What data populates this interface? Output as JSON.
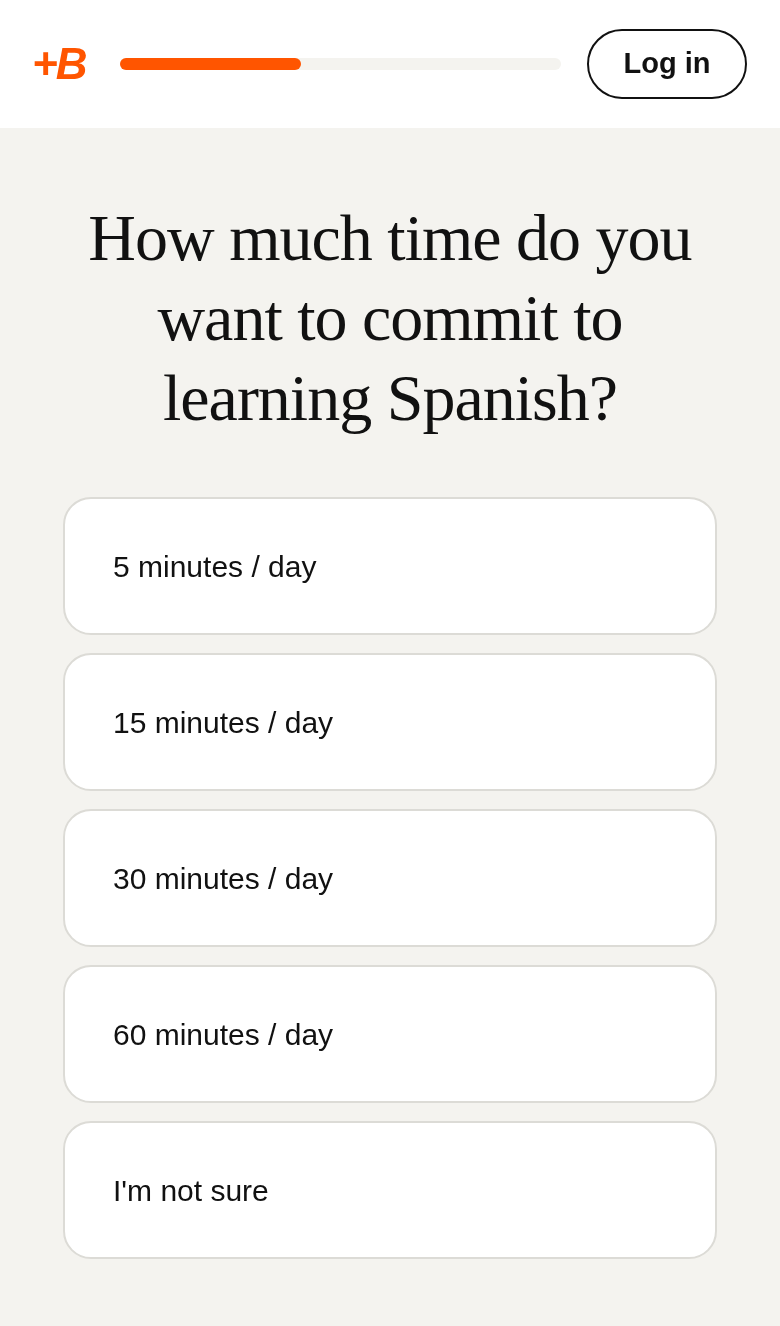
{
  "header": {
    "logo": "+B",
    "progress": {
      "level": 0.41
    },
    "login_button": "Log in"
  },
  "question": "How much time do you want to commit to learning Spanish?",
  "options": [
    {
      "label": "5 minutes / day",
      "selected": false
    },
    {
      "label": "15 minutes / day",
      "selected": false
    },
    {
      "label": "30 minutes / day",
      "selected": false
    },
    {
      "label": "60 minutes / day",
      "selected": false
    },
    {
      "label": "I'm not sure",
      "selected": false
    }
  ]
}
